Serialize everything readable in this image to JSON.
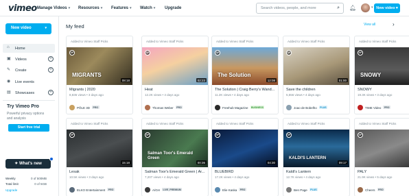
{
  "app": {
    "logo": "vimeo"
  },
  "nav": [
    {
      "label": "Manage Videos"
    },
    {
      "label": "Resources"
    },
    {
      "label": "Features"
    },
    {
      "label": "Watch"
    },
    {
      "label": "Upgrade"
    }
  ],
  "search": {
    "placeholder": "Search videos, people, and more"
  },
  "top_new_video": "New video",
  "sidebar": {
    "new_video": "New video",
    "items": [
      {
        "label": "Home"
      },
      {
        "label": "Videos"
      },
      {
        "label": "Create"
      },
      {
        "label": "Live events"
      },
      {
        "label": "Showcases"
      }
    ],
    "pro": {
      "title": "Try Vimeo Pro",
      "desc": "Powerful privacy options and analysis",
      "button": "Start free trial"
    },
    "whats_new": "What's new",
    "quota": [
      {
        "label": "Weekly",
        "value": "0 of 500MB"
      },
      {
        "label": "Total limit",
        "value": "0 of 5GB"
      }
    ],
    "upgrade": "Upgrade"
  },
  "feed": {
    "title": "My feed",
    "view_all": "View all",
    "cards": [
      {
        "added": "Added to Vimeo Staff Picks",
        "duration": "08:18",
        "title": "Migrants | 2020",
        "meta": "8,836 views • 3 days ago",
        "owner": "PÔLE 3D",
        "badge": "PRO",
        "badge_type": "pro",
        "thumb_text": "MIGRANTS"
      },
      {
        "added": "Added to Vimeo Staff Picks",
        "duration": "02:23",
        "title": "Heat",
        "meta": "12.2K views • 4 days ago",
        "owner": "Thomas Weber",
        "badge": "PRO",
        "badge_type": "pro",
        "thumb_text": ""
      },
      {
        "added": "Added to Vimeo Staff Picks",
        "duration": "12:08",
        "title": "The Solution | Craig Berry's Wand...",
        "meta": "11.2K views • 4 days ago",
        "owner": "Freehub Magazine",
        "badge": "BUSINESS",
        "badge_type": "business",
        "thumb_text": "The Solution"
      },
      {
        "added": "Added to Vimeo Staff Picks",
        "duration": "01:00",
        "title": "Save the children",
        "meta": "5,556 views • 4 days ago",
        "owner": "Joao de Bobelho",
        "badge": "PLUS",
        "badge_type": "plus",
        "thumb_text": ""
      },
      {
        "added": "Added to Vimeo Staff Picks",
        "duration": "",
        "title": "SNOWY",
        "meta": "19.3K views • 3 days ago",
        "owner": "TIME Video",
        "badge": "PRO",
        "badge_type": "pro",
        "thumb_text": "SNOWY"
      },
      {
        "added": "Added to Vimeo Staff Picks",
        "duration": "15:18",
        "title": "Lesak",
        "meta": "10.5K views • 3 days ago",
        "owner": "ELKO Entertainment",
        "badge": "PRO",
        "badge_type": "pro",
        "thumb_text": ""
      },
      {
        "added": "Added to Vimeo Staff Picks",
        "duration": "00:36",
        "title": "Salman Toor's Emerald Green | Ar...",
        "meta": "7,207 views • 4 days ago",
        "owner": "A/GH",
        "badge": "LIVE_PREMIUM",
        "badge_type": "pro",
        "thumb_text": "Salman Toor's Emerald Green"
      },
      {
        "added": "Added to Vimeo Staff Picks",
        "duration": "04:30",
        "title": "BLUEBIRD",
        "meta": "17.2K views • 4 days ago",
        "owner": "Elie Kaska",
        "badge": "PRO",
        "badge_type": "pro",
        "thumb_text": ""
      },
      {
        "added": "Added to Vimeo Staff Picks",
        "duration": "09:17",
        "title": "Kaldi's Lantern",
        "meta": "12.7K views • 4 days ago",
        "owner": "Ben Page",
        "badge": "PLUS",
        "badge_type": "plus",
        "thumb_text": "KALDI'S LANTERN"
      },
      {
        "added": "Added to Vimeo Staff Picks",
        "duration": "",
        "title": "PALY",
        "meta": "21.9K views • 5 days ago",
        "owner": "Cheers",
        "badge": "PRO",
        "badge_type": "pro",
        "thumb_text": ""
      }
    ]
  },
  "colors": {
    "accent": "#00adef",
    "dark": "#1a2e3b"
  }
}
